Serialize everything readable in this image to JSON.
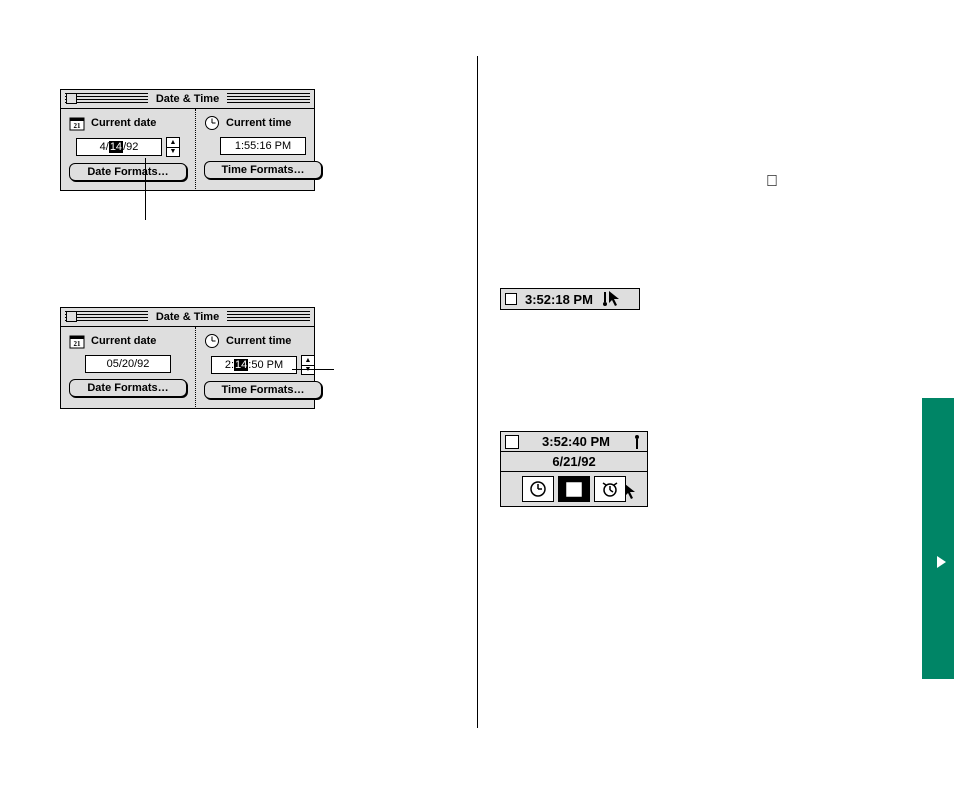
{
  "window1": {
    "title": "Date & Time",
    "left": {
      "header": "Current date",
      "value_pre": "4/",
      "value_sel": "14",
      "value_post": "/92",
      "button": "Date Formats…"
    },
    "right": {
      "header": "Current time",
      "value": "1:55:16 PM",
      "button": "Time Formats…"
    }
  },
  "window2": {
    "title": "Date & Time",
    "left": {
      "header": "Current date",
      "value": "05/20/92",
      "button": "Date Formats…"
    },
    "right": {
      "header": "Current time",
      "value_pre": "2:",
      "value_sel": "14",
      "value_post": ":50 PM",
      "button": "Time Formats…"
    }
  },
  "alarm_bar": {
    "time": "3:52:18 PM"
  },
  "alarm_expanded": {
    "time": "3:52:40 PM",
    "date": "6/21/92"
  },
  "apple_glyph": ""
}
